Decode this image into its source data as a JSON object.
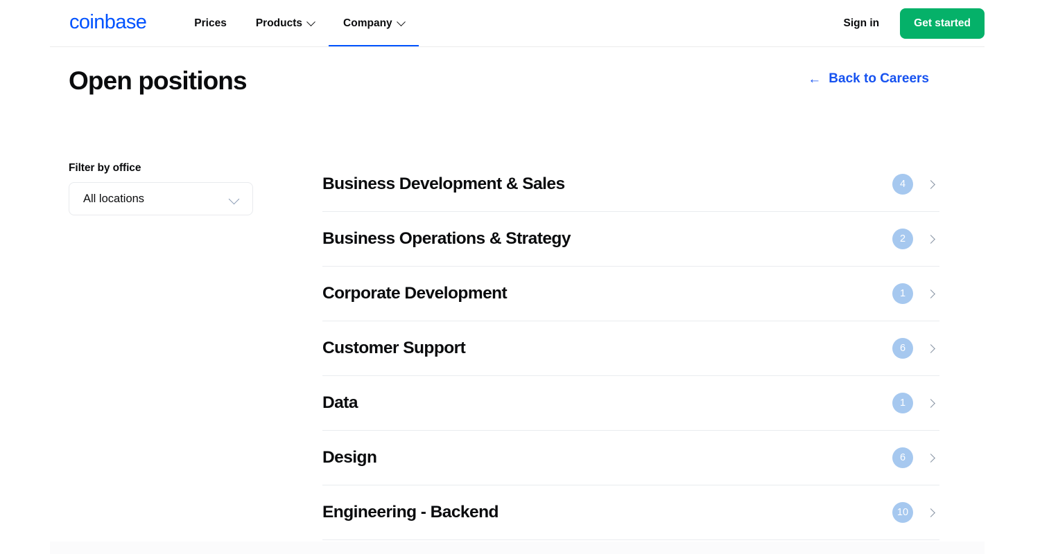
{
  "header": {
    "logo_text": "coinbase",
    "nav": [
      {
        "label": "Prices",
        "has_caret": false,
        "active": false
      },
      {
        "label": "Products",
        "has_caret": true,
        "active": false
      },
      {
        "label": "Company",
        "has_caret": true,
        "active": true
      }
    ],
    "sign_in_label": "Sign in",
    "get_started_label": "Get started",
    "accent_blue": "#0052FF",
    "accent_green": "#05b169"
  },
  "page": {
    "title": "Open positions",
    "back_link_label": "Back to Careers",
    "back_arrow_glyph": "←",
    "link_color": "#1652F0"
  },
  "filter": {
    "label": "Filter by office",
    "selected_value": "All locations",
    "options": [
      "All locations"
    ]
  },
  "job_categories": [
    {
      "name": "Business Development & Sales",
      "count": "4"
    },
    {
      "name": "Business Operations & Strategy",
      "count": "2"
    },
    {
      "name": "Corporate Development",
      "count": "1"
    },
    {
      "name": "Customer Support",
      "count": "6"
    },
    {
      "name": "Data",
      "count": "1"
    },
    {
      "name": "Design",
      "count": "6"
    },
    {
      "name": "Engineering - Backend",
      "count": "10"
    }
  ],
  "badge_color": "#a6c8ef"
}
